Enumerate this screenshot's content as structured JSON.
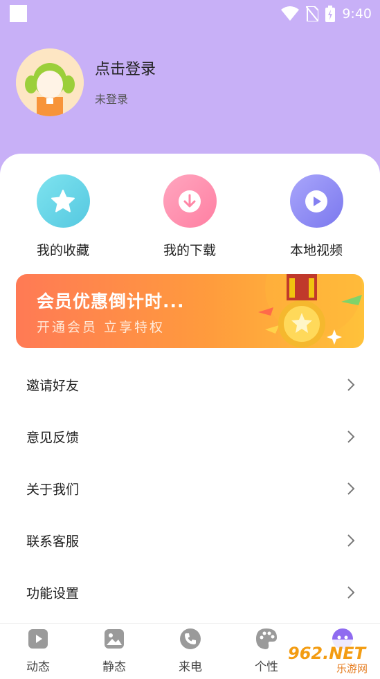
{
  "status_bar": {
    "time": "9:40"
  },
  "profile": {
    "title": "点击登录",
    "subtitle": "未登录"
  },
  "quick_actions": [
    {
      "label": "我的收藏",
      "icon": "star-icon",
      "color": "#5fd3e6"
    },
    {
      "label": "我的下载",
      "icon": "download-icon",
      "color": "#ff8fae"
    },
    {
      "label": "本地视频",
      "icon": "play-icon",
      "color": "#8f8cf5"
    }
  ],
  "banner": {
    "title": "会员优惠倒计时...",
    "subtitle": "开通会员  立享特权"
  },
  "menu": [
    {
      "label": "邀请好友"
    },
    {
      "label": "意见反馈"
    },
    {
      "label": "关于我们"
    },
    {
      "label": "联系客服"
    },
    {
      "label": "功能设置"
    }
  ],
  "tabs": [
    {
      "label": "动态",
      "icon": "video-icon"
    },
    {
      "label": "静态",
      "icon": "image-icon"
    },
    {
      "label": "来电",
      "icon": "phone-icon"
    },
    {
      "label": "个性",
      "icon": "palette-icon"
    },
    {
      "label": "",
      "icon": "profile-icon"
    }
  ],
  "watermark": {
    "brand": "962.NET",
    "site": "乐游网"
  },
  "colors": {
    "header_bg": "#c8b0f7",
    "accent": "#8f6bf0"
  }
}
